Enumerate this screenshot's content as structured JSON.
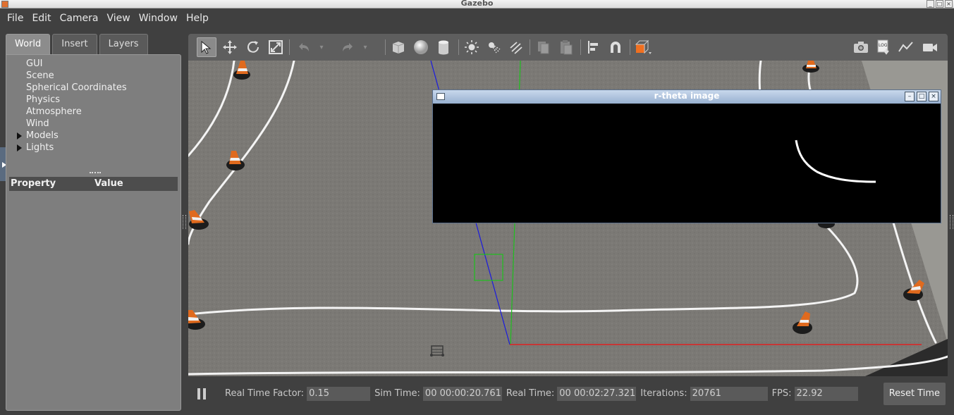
{
  "window": {
    "title": "Gazebo"
  },
  "menu": [
    "File",
    "Edit",
    "Camera",
    "View",
    "Window",
    "Help"
  ],
  "left_panel": {
    "tabs": [
      "World",
      "Insert",
      "Layers"
    ],
    "active_tab": "World",
    "tree": [
      {
        "label": "GUI",
        "expandable": false
      },
      {
        "label": "Scene",
        "expandable": false
      },
      {
        "label": "Spherical Coordinates",
        "expandable": false
      },
      {
        "label": "Physics",
        "expandable": false
      },
      {
        "label": "Atmosphere",
        "expandable": false
      },
      {
        "label": "Wind",
        "expandable": false
      },
      {
        "label": "Models",
        "expandable": true
      },
      {
        "label": "Lights",
        "expandable": true
      }
    ],
    "property_header": {
      "property": "Property",
      "value": "Value"
    }
  },
  "toolbar": {
    "tools": [
      {
        "name": "select-tool",
        "icon": "arrow-pointer-icon",
        "selected": true
      },
      {
        "name": "translate-tool",
        "icon": "move-arrows-icon"
      },
      {
        "name": "rotate-tool",
        "icon": "rotate-icon"
      },
      {
        "name": "scale-tool",
        "icon": "scale-icon"
      },
      {
        "name": "undo",
        "icon": "undo-icon"
      },
      {
        "name": "redo",
        "icon": "redo-icon"
      },
      {
        "name": "box-shape",
        "icon": "box-icon"
      },
      {
        "name": "sphere-shape",
        "icon": "sphere-icon"
      },
      {
        "name": "cylinder-shape",
        "icon": "cylinder-icon"
      },
      {
        "name": "point-light",
        "icon": "sun-icon"
      },
      {
        "name": "spot-light",
        "icon": "spotlight-icon"
      },
      {
        "name": "directional-light",
        "icon": "directional-light-icon"
      },
      {
        "name": "copy",
        "icon": "copy-icon"
      },
      {
        "name": "paste",
        "icon": "paste-icon"
      },
      {
        "name": "align",
        "icon": "align-icon"
      },
      {
        "name": "snap",
        "icon": "magnet-icon"
      },
      {
        "name": "view-angle",
        "icon": "view-angle-icon"
      },
      {
        "name": "screenshot",
        "icon": "camera-icon"
      },
      {
        "name": "log",
        "icon": "log-icon"
      },
      {
        "name": "plot",
        "icon": "plot-icon"
      },
      {
        "name": "video",
        "icon": "video-icon"
      }
    ],
    "log_label": "LOG"
  },
  "popup": {
    "title": "r-theta image"
  },
  "colors": {
    "accent_orange": "#f07020",
    "cone_orange": "#e06a1e",
    "track_white": "#f4f4f4",
    "axis_red": "#e02020",
    "axis_green": "#20c020",
    "axis_blue": "#2020e0"
  },
  "bottom_bar": {
    "real_time_factor_label": "Real Time Factor:",
    "real_time_factor": "0.15",
    "sim_time_label": "Sim Time:",
    "sim_time": "00 00:00:20.761",
    "real_time_label": "Real Time:",
    "real_time": "00 00:02:27.321",
    "iterations_label": "Iterations:",
    "iterations": "20761",
    "fps_label": "FPS:",
    "fps": "22.92",
    "reset_button": "Reset Time"
  }
}
